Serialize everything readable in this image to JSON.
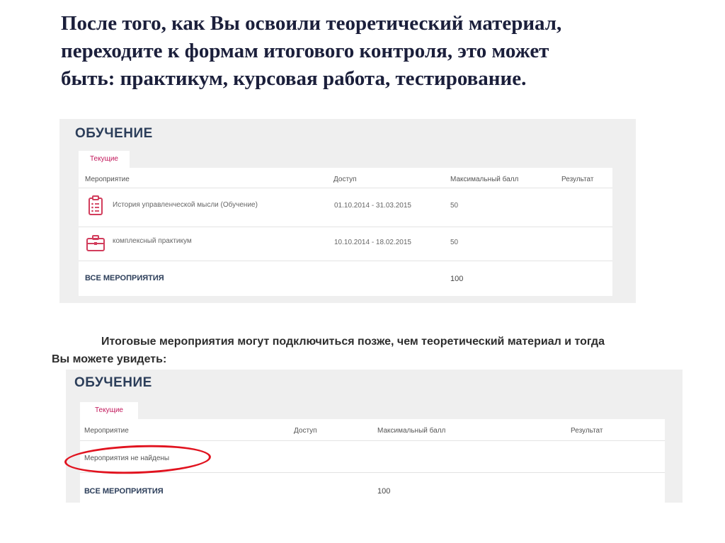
{
  "heading": {
    "line1": "После того, как Вы освоили теоретический материал,",
    "line2": "переходите к формам итогового контроля, это может",
    "line3": "быть: практикум, курсовая работа, тестирование."
  },
  "panel1": {
    "title": "ОБУЧЕНИЕ",
    "tab": "Текущие",
    "columns": [
      "Мероприятие",
      "Доступ",
      "Максимальный балл",
      "Результат"
    ],
    "rows": [
      {
        "icon": "clipboard-list-icon",
        "name": "История управленческой мысли (Обучение)",
        "access": "01.10.2014 - 31.03.2015",
        "max": "50"
      },
      {
        "icon": "briefcase-icon",
        "name": "комплексный практикум",
        "access": "10.10.2014 - 18.02.2015",
        "max": "50"
      }
    ],
    "total_label": "ВСЕ МЕРОПРИЯТИЯ",
    "total_value": "100"
  },
  "note": {
    "line1": "Итоговые мероприятия могут подключиться позже, чем теоретический материал и тогда",
    "line2": "Вы можете увидеть:"
  },
  "panel2": {
    "title": "ОБУЧЕНИЕ",
    "tab": "Текущие",
    "columns": [
      "Мероприятие",
      "Доступ",
      "Максимальный балл",
      "Результат"
    ],
    "empty": "Мероприятия не найдены",
    "total_label": "ВСЕ МЕРОПРИЯТИЯ",
    "total_value": "100"
  },
  "colors": {
    "accent": "#c2185b",
    "highlight": "#e1131f",
    "title": "#2c3e5a"
  }
}
